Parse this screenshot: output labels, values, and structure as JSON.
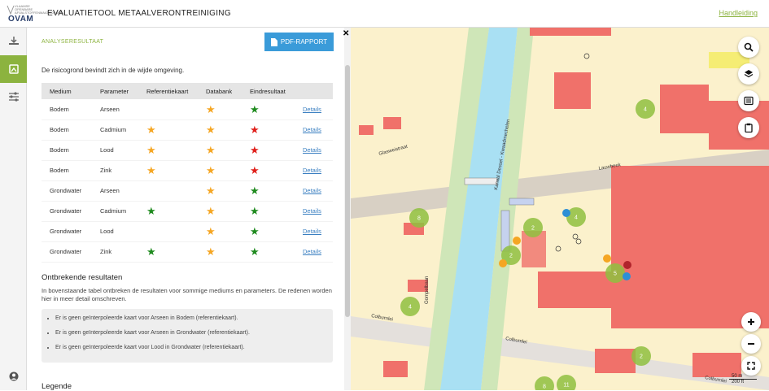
{
  "header": {
    "logo_small": "VLAAMSE OPENBARE AFVALSTOFFENMAATSCHAPPIJ",
    "logo_text": "OVAM",
    "title": "EVALUATIETOOL METAALVERONTREINIGING",
    "help_link": "Handleiding"
  },
  "panel": {
    "section_label": "ANALYSERESULTAAT",
    "pdf_button": "PDF-RAPPORT",
    "intro": "De risicogrond bevindt zich in de wijde omgeving.",
    "table": {
      "headers": [
        "Medium",
        "Parameter",
        "Referentiekaart",
        "Databank",
        "Eindresultaat",
        ""
      ],
      "rows": [
        {
          "medium": "Bodem",
          "parameter": "Arseen",
          "ref": "",
          "db": "orange",
          "end": "green",
          "link": "Details"
        },
        {
          "medium": "Bodem",
          "parameter": "Cadmium",
          "ref": "orange",
          "db": "orange",
          "end": "red",
          "link": "Details"
        },
        {
          "medium": "Bodem",
          "parameter": "Lood",
          "ref": "orange",
          "db": "orange",
          "end": "red",
          "link": "Details"
        },
        {
          "medium": "Bodem",
          "parameter": "Zink",
          "ref": "orange",
          "db": "orange",
          "end": "red",
          "link": "Details"
        },
        {
          "medium": "Grondwater",
          "parameter": "Arseen",
          "ref": "",
          "db": "orange",
          "end": "green",
          "link": "Details"
        },
        {
          "medium": "Grondwater",
          "parameter": "Cadmium",
          "ref": "green",
          "db": "orange",
          "end": "green",
          "link": "Details"
        },
        {
          "medium": "Grondwater",
          "parameter": "Lood",
          "ref": "",
          "db": "orange",
          "end": "green",
          "link": "Details"
        },
        {
          "medium": "Grondwater",
          "parameter": "Zink",
          "ref": "green",
          "db": "orange",
          "end": "green",
          "link": "Details"
        }
      ]
    },
    "missing_title": "Ontbrekende resultaten",
    "missing_text": "In bovenstaande tabel ontbreken de resultaten voor sommige mediums en parameters. De redenen worden hier in meer detail omschreven.",
    "notes": [
      "Er is geen geïnterpoleerde kaart voor Arseen in Bodem (referentiekaart).",
      "Er is geen geïnterpoleerde kaart voor Arseen in Grondwater (referentiekaart).",
      "Er is geen geïnterpoleerde kaart voor Lood in Grondwater (referentiekaart)."
    ],
    "legend_title": "Legende"
  },
  "colors": {
    "orange": "#f5a623",
    "green": "#1e8a1e",
    "red": "#e0201b",
    "accent": "#8cb33f",
    "button": "#3a9bd9"
  },
  "map": {
    "streets": [
      "Glasweistraat",
      "Kanaal Dessel - Kwaadmechelen",
      "Gompelbaan",
      "Colburnlei",
      "Colbumlei",
      "Lauwbeek",
      "Colburnlei"
    ],
    "clusters": [
      "4",
      "8",
      "2",
      "4",
      "2",
      "5",
      "4",
      "2",
      "8",
      "11"
    ],
    "scale": {
      "metric": "50 m",
      "imperial": "200 ft"
    }
  },
  "icons": {
    "rail": [
      "layers-toggle-icon",
      "results-icon",
      "settings-sliders-icon",
      "user-icon"
    ],
    "map": [
      "search-icon",
      "layers-icon",
      "list-icon",
      "clipboard-icon",
      "zoom-in-icon",
      "zoom-out-icon",
      "fullscreen-icon"
    ]
  }
}
